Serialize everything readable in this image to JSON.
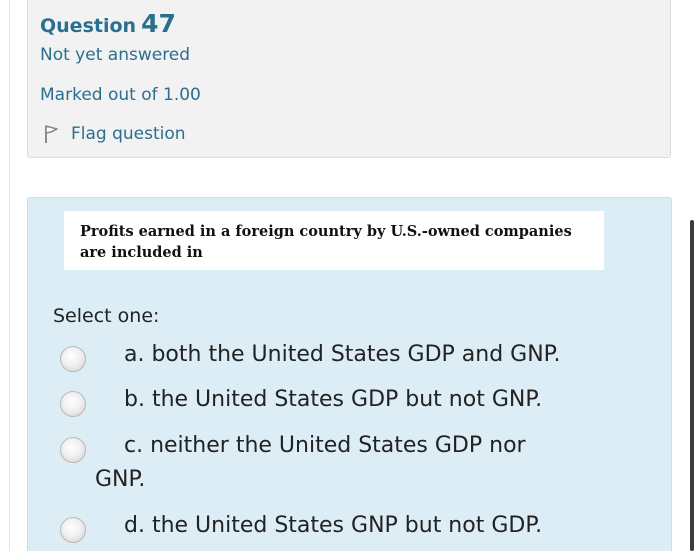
{
  "question": {
    "title_word": "Question",
    "number": "47",
    "status": "Not yet answered",
    "marks": "Marked out of 1.00",
    "flag_label": "Flag question",
    "flag_icon": "flag-icon"
  },
  "content": {
    "question_text": "Profits earned in a foreign country by U.S.-owned companies are included in",
    "prompt": "Select one:",
    "options": [
      {
        "line1": "a. both the United States GDP and GNP.",
        "line2": ""
      },
      {
        "line1": "b. the United States GDP but not GNP.",
        "line2": ""
      },
      {
        "line1": "c. neither the United States GDP nor",
        "line2": "GNP."
      },
      {
        "line1": "d. the United States GNP but not GDP.",
        "line2": ""
      }
    ]
  },
  "colors": {
    "info_panel_bg": "#f2f2f2",
    "content_panel_bg": "#dcedf6",
    "link_blue": "#2a6f8f"
  }
}
